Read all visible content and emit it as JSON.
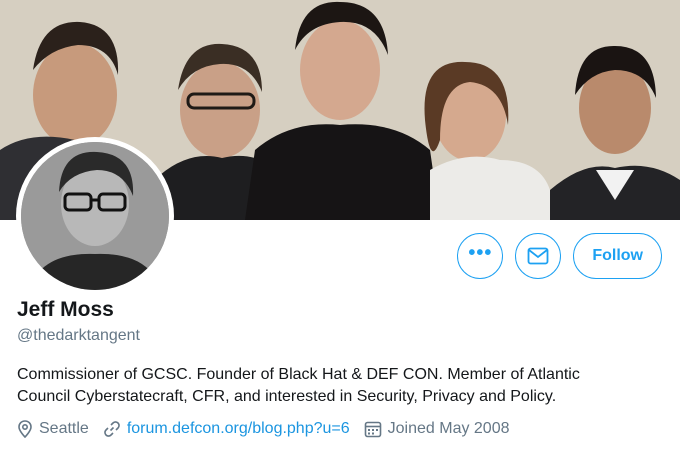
{
  "profile": {
    "name": "Jeff Moss",
    "handle": "@thedarktangent",
    "bio": "Commissioner of GCSC. Founder of Black Hat & DEF CON. Member of Atlantic Council Cyberstatecraft, CFR, and interested in Security, Privacy and Policy.",
    "location": "Seattle",
    "website": "forum.defcon.org/blog.php?u=6",
    "joined": "Joined May 2008"
  },
  "actions": {
    "more_label": "•••",
    "message_icon": "envelope-icon",
    "follow_label": "Follow"
  },
  "colors": {
    "accent": "#1da1f2",
    "link": "#1b95e0",
    "secondary_text": "#657786"
  }
}
